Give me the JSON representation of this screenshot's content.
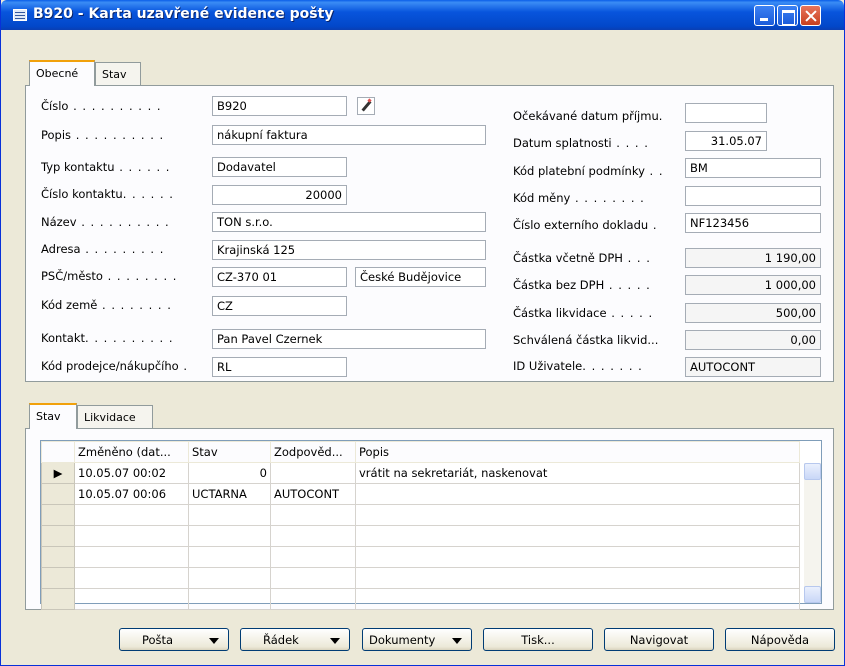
{
  "window": {
    "title": "B920 - Karta uzavřené evidence pošty"
  },
  "top_tabs": [
    {
      "label": "Obecné"
    },
    {
      "label": "Stav"
    }
  ],
  "left_fields": [
    {
      "label": "Číslo",
      "value": "B920"
    },
    {
      "label": "Popis",
      "value": "nákupní faktura"
    },
    {
      "label": "Typ kontaktu",
      "value": "Dodavatel"
    },
    {
      "label": "Číslo kontaktu",
      "value": "20000"
    },
    {
      "label": "Název",
      "value": "TON s.r.o."
    },
    {
      "label": "Adresa",
      "value": "Krajinská 125"
    },
    {
      "label": "PSČ/město",
      "value": "CZ-370 01",
      "value2": "České Budějovice"
    },
    {
      "label": "Kód země",
      "value": "CZ"
    },
    {
      "label": "Kontakt",
      "value": "Pan Pavel Czernek"
    },
    {
      "label": "Kód prodejce/nákupčího",
      "value": "RL"
    }
  ],
  "right_fields": [
    {
      "label": "Očekávané datum příjmu",
      "value": ""
    },
    {
      "label": "Datum splatnosti",
      "value": "31.05.07"
    },
    {
      "label": "Kód platební podmínky",
      "value": "BM"
    },
    {
      "label": "Kód měny",
      "value": ""
    },
    {
      "label": "Číslo externího dokladu",
      "value": "NF123456"
    },
    {
      "label": "Částka včetně DPH",
      "value": "1 190,00"
    },
    {
      "label": "Částka bez DPH",
      "value": "1 000,00"
    },
    {
      "label": "Částka likvidace",
      "value": "500,00"
    },
    {
      "label": "Schválená částka likvid...",
      "value": "0,00"
    },
    {
      "label": "ID Uživatele",
      "value": "AUTOCONT"
    }
  ],
  "bottom_tabs": [
    {
      "label": "Stav"
    },
    {
      "label": "Likvidace"
    }
  ],
  "grid": {
    "columns": [
      "Změněno (dat...",
      "Stav",
      "Zodpověd...",
      "Popis"
    ],
    "rows": [
      {
        "changed": "10.05.07 00:02",
        "status": "0",
        "responsible": "",
        "description": "vrátit na sekretariát, naskenovat"
      },
      {
        "changed": "10.05.07 00:06",
        "status": "UCTARNA",
        "responsible": "AUTOCONT",
        "description": ""
      }
    ]
  },
  "buttons": {
    "posta": "Pošta",
    "radek": "Řádek",
    "dokumenty": "Dokumenty",
    "tisk": "Tisk...",
    "navigovat": "Navigovat",
    "napoveda": "Nápověda"
  }
}
